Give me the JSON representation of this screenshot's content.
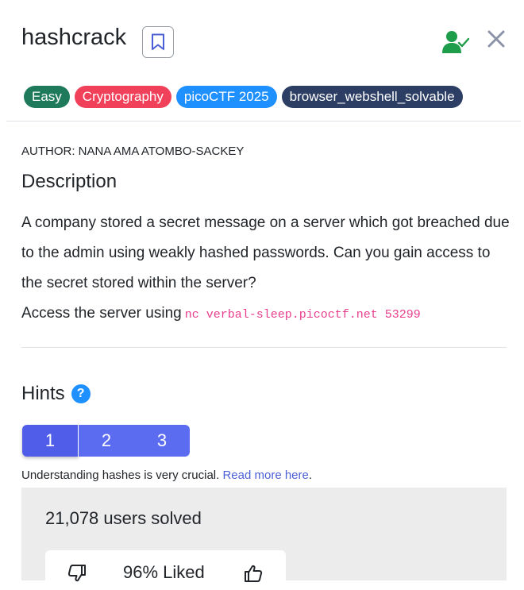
{
  "challenge": {
    "title": "hashcrack",
    "tags": [
      {
        "label": "Easy",
        "color": "#1f7a5c"
      },
      {
        "label": "Cryptography",
        "color": "#f0405a"
      },
      {
        "label": "picoCTF 2025",
        "color": "#1e90ff"
      },
      {
        "label": "browser_webshell_solvable",
        "color": "#2c3e64"
      }
    ]
  },
  "author": "AUTHOR: NANA AMA ATOMBO-SACKEY",
  "description": {
    "heading": "Description",
    "body": "A company stored a secret message on a server which got breached due to the admin using weakly hashed passwords. Can you gain access to the secret stored within the server?",
    "access_prefix": "Access the server using",
    "access_command": "nc verbal-sleep.picoctf.net 53299"
  },
  "hints": {
    "heading": "Hints",
    "help_symbol": "?",
    "tabs": [
      "1",
      "2",
      "3"
    ],
    "active_tab": "1",
    "text": "Understanding hashes is very crucial.",
    "link_text": "Read more here",
    "trailing": "."
  },
  "stats": {
    "solved": "21,078 users solved",
    "liked": "96% Liked"
  },
  "colors": {
    "solved_user_icon": "#1e9e4a",
    "close_icon": "#8a94a6",
    "hint_tab": "#5b6cf0"
  },
  "icons": {
    "bookmark": "bookmark-icon",
    "solved": "user-check-icon",
    "close": "close-icon",
    "help": "question-circle-icon",
    "dislike": "thumbs-down-icon",
    "like": "thumbs-up-icon"
  }
}
